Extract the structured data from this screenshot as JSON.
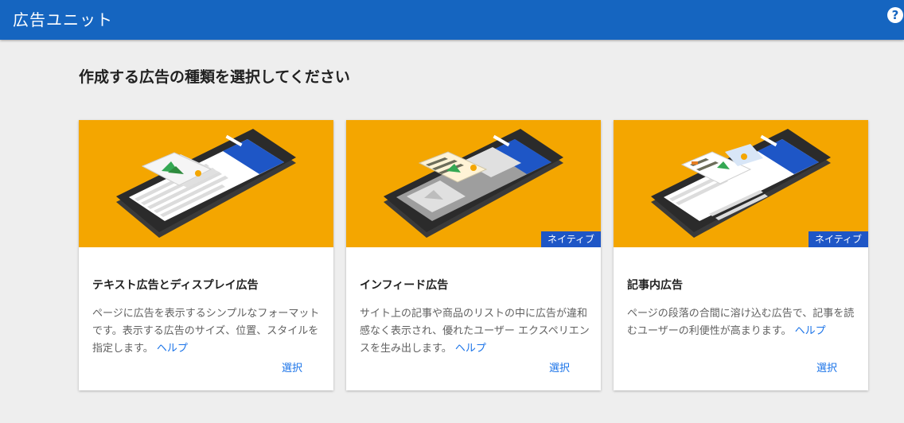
{
  "header": {
    "title": "広告ユニット",
    "help_label": "?"
  },
  "main": {
    "heading": "作成する広告の種類を選択してください",
    "cards": [
      {
        "title": "テキスト広告とディスプレイ広告",
        "description": "ページに広告を表示するシンプルなフォーマットです。表示する広告のサイズ、位置、スタイルを指定します。",
        "help_link": "ヘルプ",
        "select_label": "選択",
        "badge": ""
      },
      {
        "title": "インフィード広告",
        "description": "サイト上の記事や商品のリストの中に広告が違和感なく表示され、優れたユーザー エクスペリエンスを生み出します。",
        "help_link": "ヘルプ",
        "select_label": "選択",
        "badge": "ネイティブ"
      },
      {
        "title": "記事内広告",
        "description": "ページの段落の合間に溶け込む広告で、記事を読むユーザーの利便性が高まります。",
        "help_link": "ヘルプ",
        "select_label": "選択",
        "badge": "ネイティブ"
      }
    ]
  },
  "colors": {
    "header_bg": "#1565c0",
    "card_media_bg": "#f4a600",
    "badge_bg": "#1e56c6",
    "link": "#1a73e8"
  }
}
